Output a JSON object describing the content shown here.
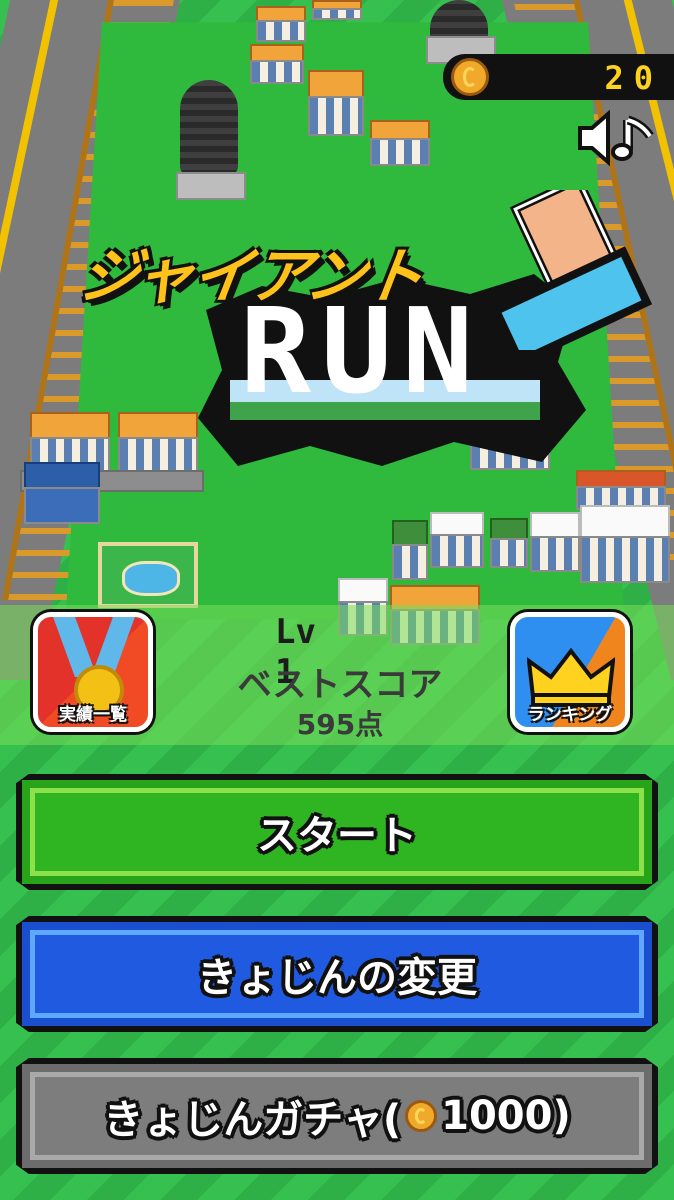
{
  "game": {
    "title_kana": "ジャイアント",
    "title_latin": "RUN",
    "coin_count": "20"
  },
  "icons": {
    "coin": "coin-icon",
    "sound": "speaker-music-icon",
    "achievements": "medal-icon",
    "ranking": "crown-icon"
  },
  "status": {
    "level_label": "Lv",
    "level_value": "1",
    "best_score_label": "ベストスコア",
    "best_score_value": "595点"
  },
  "side_buttons": {
    "achievements_label": "実績一覧",
    "ranking_label": "ランキング"
  },
  "menu": {
    "start_label": "スタート",
    "change_giant_label": "きょじんの変更",
    "gacha_label_prefix": "きょじんガチャ(",
    "gacha_cost": "1000",
    "gacha_label_suffix": ")"
  },
  "colors": {
    "start_green": "#27a41a",
    "change_blue": "#1a4fd0",
    "gacha_gray": "#6c6c6c",
    "coin_text": "#ffd21f"
  }
}
